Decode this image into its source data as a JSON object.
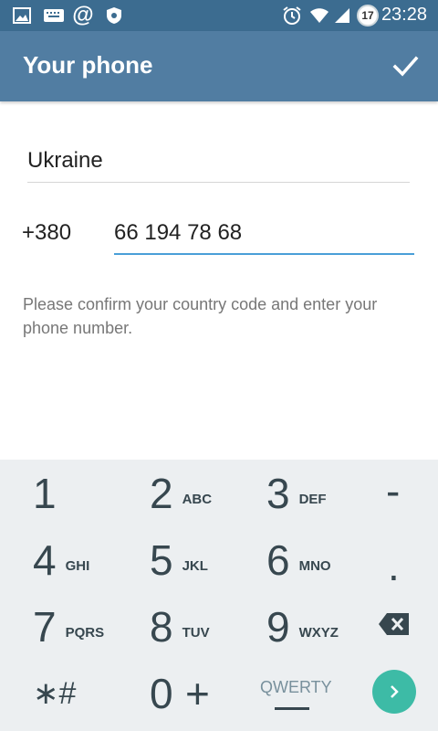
{
  "status_bar": {
    "time": "23:28",
    "notification_count": "17"
  },
  "app_bar": {
    "title": "Your phone"
  },
  "form": {
    "country": "Ukraine",
    "country_code": "+380",
    "phone_number": "66 194 78 68",
    "hint": "Please confirm your country code and enter your phone number."
  },
  "keypad": {
    "rows": [
      [
        {
          "digit": "1",
          "letters": ""
        },
        {
          "digit": "2",
          "letters": "ABC"
        },
        {
          "digit": "3",
          "letters": "DEF"
        },
        {
          "digit": "-",
          "letters": ""
        }
      ],
      [
        {
          "digit": "4",
          "letters": "GHI"
        },
        {
          "digit": "5",
          "letters": "JKL"
        },
        {
          "digit": "6",
          "letters": "MNO"
        },
        {
          "digit": ".",
          "letters": ""
        }
      ],
      [
        {
          "digit": "7",
          "letters": "PQRS"
        },
        {
          "digit": "8",
          "letters": "TUV"
        },
        {
          "digit": "9",
          "letters": "WXYZ"
        }
      ],
      [
        {
          "digit": "∗#",
          "letters": ""
        },
        {
          "digit": "0",
          "letters": ""
        },
        {
          "digit": "+",
          "letters": ""
        }
      ]
    ],
    "qwerty_label": "QWERTY"
  },
  "colors": {
    "status_bar": "#3c6c90",
    "app_bar": "#517da2",
    "input_focus": "#4a9fd8",
    "next_button": "#3dbba6",
    "keypad_bg": "#eceff1"
  }
}
